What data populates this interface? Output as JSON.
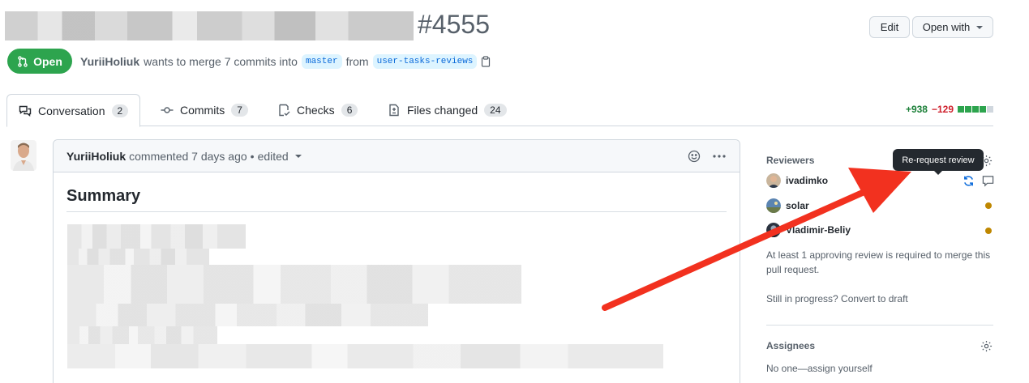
{
  "header": {
    "pr_number": "#4555",
    "edit_label": "Edit",
    "open_with_label": "Open with"
  },
  "status": {
    "state_label": "Open",
    "author": "YuriiHoliuk",
    "merge_text": "wants to merge 7 commits into",
    "base_branch": "master",
    "from_text": "from",
    "head_branch": "user-tasks-reviews"
  },
  "tabs": [
    {
      "label": "Conversation",
      "count": "2"
    },
    {
      "label": "Commits",
      "count": "7"
    },
    {
      "label": "Checks",
      "count": "6"
    },
    {
      "label": "Files changed",
      "count": "24"
    }
  ],
  "diffstat": {
    "additions": "+938",
    "deletions": "−129"
  },
  "comment": {
    "author": "YuriiHoliuk",
    "action": "commented 7 days ago",
    "separator": "•",
    "edited": "edited",
    "heading": "Summary"
  },
  "sidebar": {
    "reviewers_heading": "Reviewers",
    "reviewers": [
      {
        "name": "ivadimko"
      },
      {
        "name": "solar"
      },
      {
        "name": "Vladimir-Beliy"
      }
    ],
    "approval_note": "At least 1 approving review is required to merge this pull request.",
    "draft_note": "Still in progress? Convert to draft",
    "assignees_heading": "Assignees",
    "assignees_value": "No one—assign yourself"
  },
  "tooltip": {
    "text": "Re-request review"
  },
  "colors": {
    "open_green": "#2da44e",
    "annotation_arrow": "#f2311f",
    "pending_dot": "#bf8700",
    "link_blue": "#0969da"
  }
}
